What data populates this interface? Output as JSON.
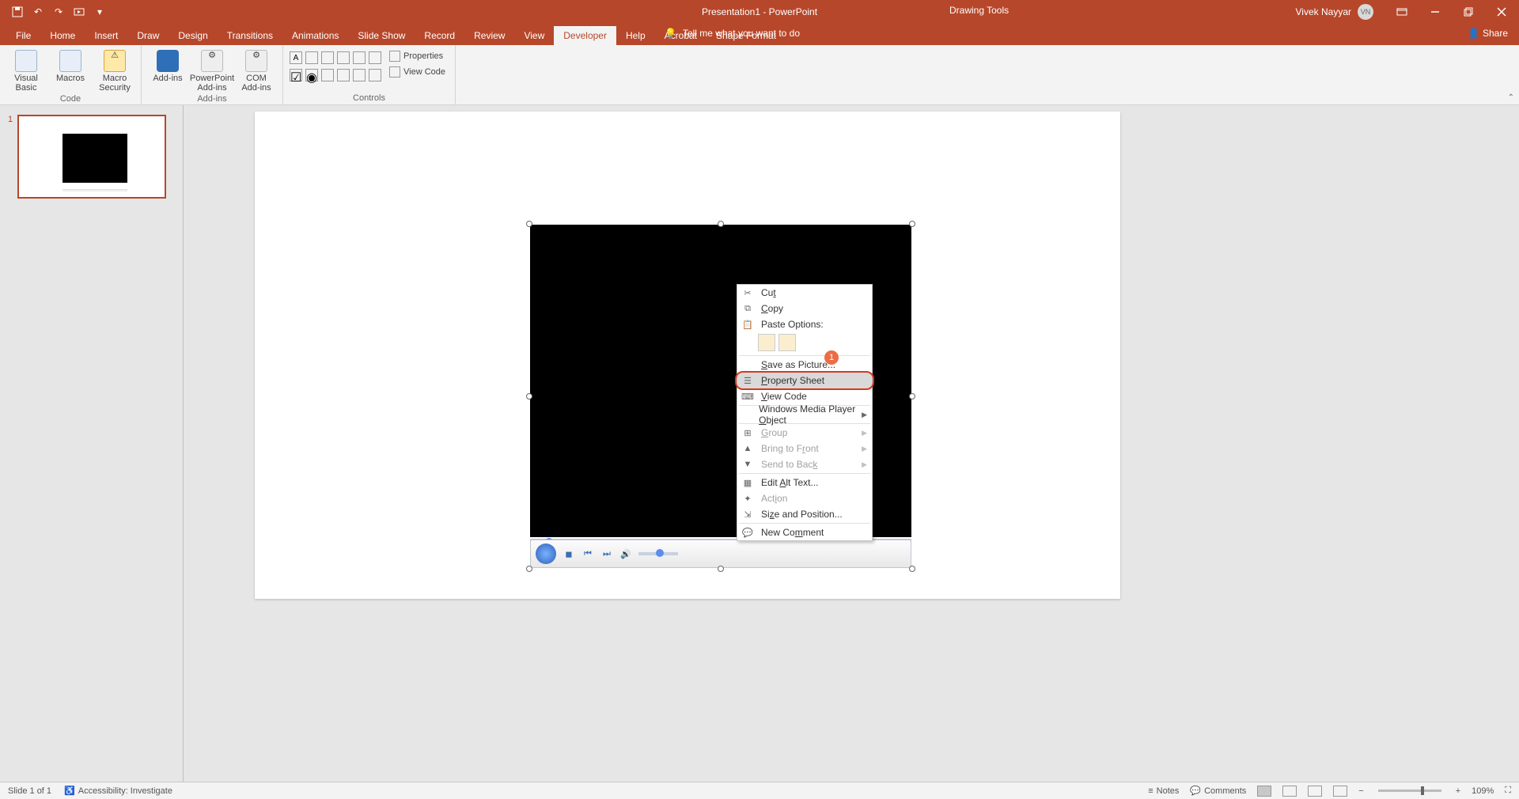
{
  "title": {
    "doc": "Presentation1",
    "app": "PowerPoint",
    "tool": "Drawing Tools",
    "user": "Vivek Nayyar",
    "initials": "VN"
  },
  "qat": {
    "save": "💾",
    "undo": "↶",
    "redo": "↷",
    "start": "▢"
  },
  "tabs": {
    "file": "File",
    "home": "Home",
    "insert": "Insert",
    "draw": "Draw",
    "design": "Design",
    "transitions": "Transitions",
    "animations": "Animations",
    "slideshow": "Slide Show",
    "record": "Record",
    "review": "Review",
    "view": "View",
    "developer": "Developer",
    "help": "Help",
    "acrobat": "Acrobat",
    "shapeformat": "Shape Format",
    "tellme": "Tell me what you want to do",
    "share": "Share"
  },
  "ribbon": {
    "code": {
      "vb": "Visual Basic",
      "macros": "Macros",
      "security": "Macro Security",
      "label": "Code"
    },
    "addins": {
      "addins": "Add-ins",
      "ppt": "PowerPoint Add-ins",
      "com": "COM Add-ins",
      "label": "Add-ins"
    },
    "controls": {
      "properties": "Properties",
      "viewcode": "View Code",
      "label": "Controls"
    }
  },
  "thumb": {
    "num": "1"
  },
  "ctx": {
    "cut": "Cut",
    "copy": "Copy",
    "paste_options": "Paste Options:",
    "save_pic": "Save as Picture...",
    "prop_sheet": "Property Sheet",
    "view_code": "View Code",
    "wmp": "Windows Media Player Object",
    "group": "Group",
    "bring_front": "Bring to Front",
    "send_back": "Send to Back",
    "alt_text": "Edit Alt Text...",
    "action": "Action",
    "size_pos": "Size and Position...",
    "new_comment": "New Comment",
    "badge": "1"
  },
  "status": {
    "slide": "Slide 1 of 1",
    "accessibility": "Accessibility: Investigate",
    "notes": "Notes",
    "comments": "Comments",
    "zoom": "109%",
    "minus": "−",
    "plus": "+",
    "fit": "⛶"
  }
}
